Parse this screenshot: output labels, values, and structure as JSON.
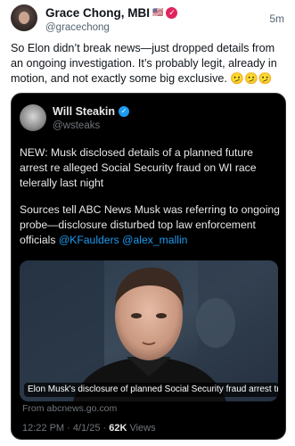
{
  "post": {
    "display_name": "Grace Chong, MBI",
    "flag": "🇺🇸",
    "badge_icon": "pink-verified-badge-icon",
    "handle": "@gracechong",
    "time": "5m",
    "text": "So Elon didn’t break news—just dropped details from an ongoing investigation. It’s probably legit, already in motion, and not exactly some big exclusive. 🫤🫤🫤"
  },
  "quoted": {
    "display_name": "Will Steakin",
    "verified_icon": "blue-verified-icon",
    "handle": "@wsteaks",
    "paragraph1": "NEW: Musk disclosed details of a planned future arrest re alleged Social Security fraud on WI race telerally last night",
    "paragraph2_prefix": "Sources tell ABC News Musk was referring to ongoing probe—disclosure disturbed top law enforcement officials ",
    "mention1": "@KFaulders",
    "mention2": "@alex_mallin",
    "media_caption": "Elon Musk's disclosure of planned Social Security fraud arrest troubl...",
    "source": "From abcnews.go.com",
    "time": "12:22 PM · 4/1/25 · ",
    "views_count": "62K",
    "views_label": " Views"
  },
  "colors": {
    "accent_blue": "#1d9bf0",
    "card_background": "#000000",
    "badge_pink": "#e0245e"
  }
}
